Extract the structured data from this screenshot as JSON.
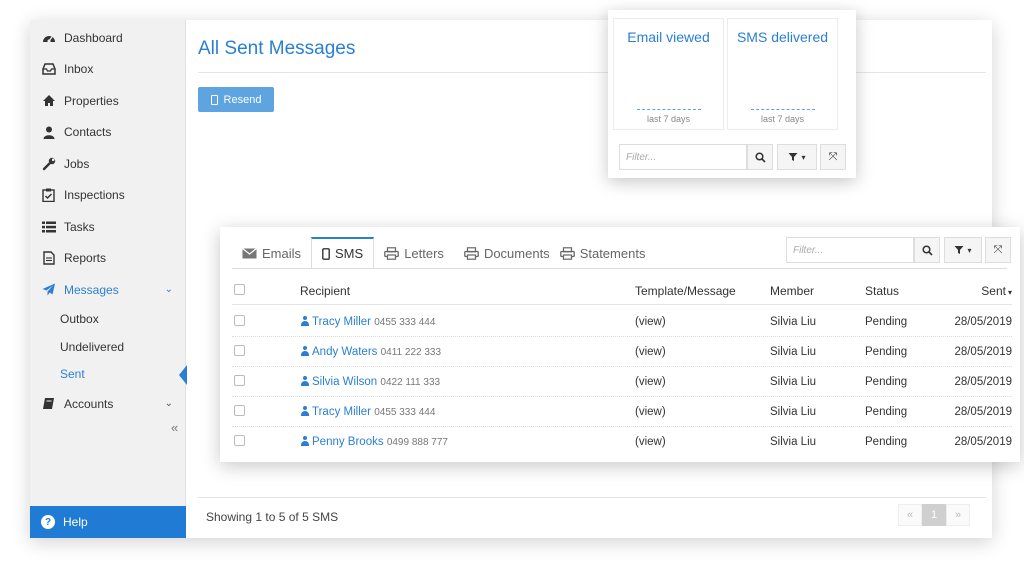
{
  "sidebar": {
    "items": [
      {
        "label": "Dashboard",
        "icon": "dashboard-icon"
      },
      {
        "label": "Inbox",
        "icon": "inbox-icon"
      },
      {
        "label": "Properties",
        "icon": "home-icon"
      },
      {
        "label": "Contacts",
        "icon": "user-icon"
      },
      {
        "label": "Jobs",
        "icon": "wrench-icon"
      },
      {
        "label": "Inspections",
        "icon": "clipboard-check-icon"
      },
      {
        "label": "Tasks",
        "icon": "list-icon"
      },
      {
        "label": "Reports",
        "icon": "file-icon"
      },
      {
        "label": "Messages",
        "icon": "paper-plane-icon"
      },
      {
        "label": "Accounts",
        "icon": "book-icon"
      }
    ],
    "messages_submenu": [
      "Outbox",
      "Undelivered",
      "Sent"
    ],
    "collapse_glyph": "«",
    "help_label": "Help"
  },
  "page": {
    "title": "All Sent Messages",
    "resend_label": "Resend",
    "showing_text": "Showing 1 to 5 of 5 SMS",
    "pager": {
      "prev": "«",
      "current": "1",
      "next": "»"
    }
  },
  "stats": {
    "cards": [
      {
        "title": "Email viewed",
        "subtitle": "last 7 days"
      },
      {
        "title": "SMS delivered",
        "subtitle": "last 7 days"
      }
    ],
    "filter_placeholder": "Filter..."
  },
  "table": {
    "tabs": [
      "Emails",
      "SMS",
      "Letters",
      "Documents",
      "Statements"
    ],
    "active_tab": "SMS",
    "filter_placeholder": "Filter...",
    "columns": [
      "Recipient",
      "Template/Message",
      "Member",
      "Status",
      "Sent"
    ],
    "rows": [
      {
        "name": "Tracy Miller",
        "phone": "0455 333 444",
        "template": "(view)",
        "member": "Silvia Liu",
        "status": "Pending",
        "sent": "28/05/2019"
      },
      {
        "name": "Andy Waters",
        "phone": "0411 222 333",
        "template": "(view)",
        "member": "Silvia Liu",
        "status": "Pending",
        "sent": "28/05/2019"
      },
      {
        "name": "Silvia Wilson",
        "phone": "0422 111 333",
        "template": "(view)",
        "member": "Silvia Liu",
        "status": "Pending",
        "sent": "28/05/2019"
      },
      {
        "name": "Tracy Miller",
        "phone": "0455 333 444",
        "template": "(view)",
        "member": "Silvia Liu",
        "status": "Pending",
        "sent": "28/05/2019"
      },
      {
        "name": "Penny Brooks",
        "phone": "0499 888 777",
        "template": "(view)",
        "member": "Silvia Liu",
        "status": "Pending",
        "sent": "28/05/2019"
      }
    ]
  },
  "colors": {
    "accent": "#2a7fd4",
    "help_bar": "#1f7bd3",
    "resend_button": "#5ea4e0"
  }
}
